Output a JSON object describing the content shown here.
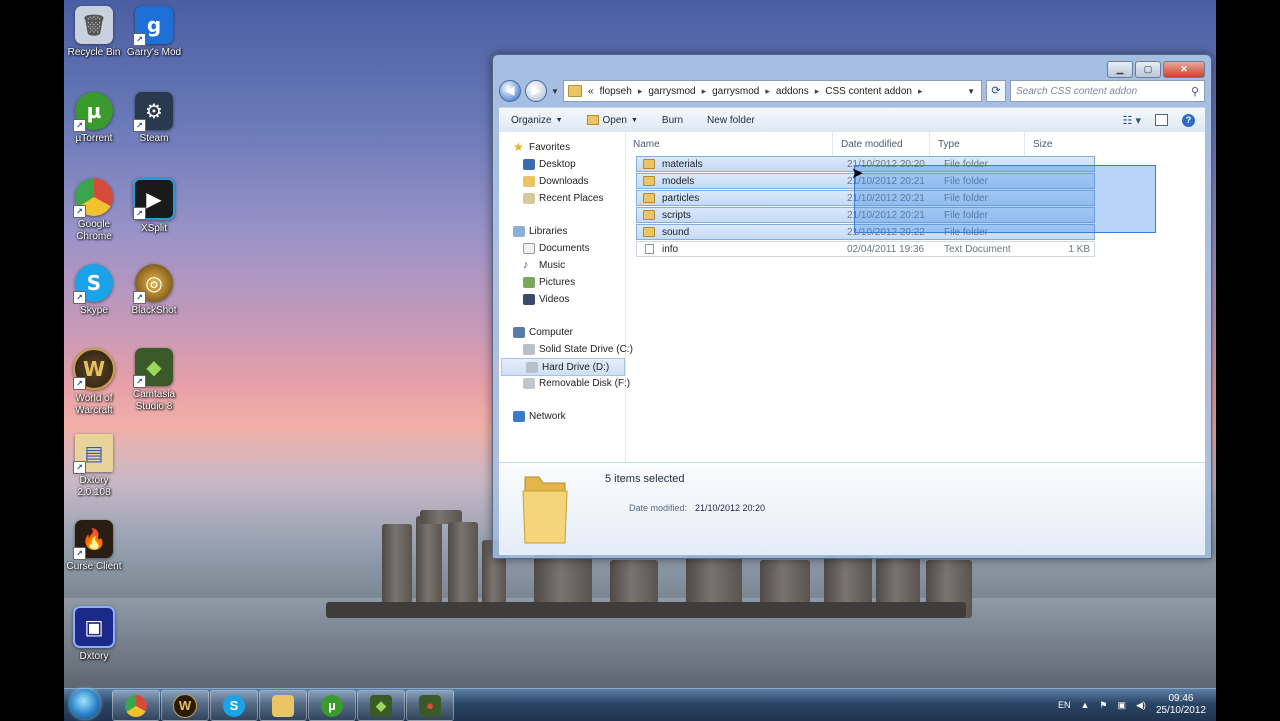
{
  "desktop": {
    "icons": [
      {
        "label": "Recycle Bin",
        "glyph": "🗑",
        "color": "#c9d2dc",
        "icon": "recycle-bin-icon"
      },
      {
        "label": "Garry's Mod",
        "glyph": "g",
        "color": "#1e6fd6",
        "icon": "garrys-mod-icon"
      },
      {
        "label": "µTorrent",
        "glyph": "µ",
        "color": "#3a9a2c",
        "icon": "utorrent-icon"
      },
      {
        "label": "Steam",
        "glyph": "⚙",
        "color": "#2a3a4e",
        "icon": "steam-icon"
      },
      {
        "label": "Google Chrome",
        "glyph": "◉",
        "color": "#d64a3a",
        "icon": "chrome-icon"
      },
      {
        "label": "XSplit",
        "glyph": "▶",
        "color": "#1a1a1a",
        "icon": "xsplit-icon"
      },
      {
        "label": "Skype",
        "glyph": "S",
        "color": "#1aa3e8",
        "icon": "skype-icon"
      },
      {
        "label": "BlackShot",
        "glyph": "◎",
        "color": "#8a6a1a",
        "icon": "blackshot-icon"
      },
      {
        "label": "World of Warcraft",
        "glyph": "W",
        "color": "#9a7a2a",
        "icon": "wow-icon"
      },
      {
        "label": "Camtasia Studio 8",
        "glyph": "◆",
        "color": "#3a5a2a",
        "icon": "camtasia-icon"
      },
      {
        "label": "Dxtory 2.0.108",
        "glyph": "▤",
        "color": "#d8c89a",
        "icon": "dxtory-folder-icon"
      },
      {
        "label": "Curse Client",
        "glyph": "🔥",
        "color": "#3a2a1a",
        "icon": "curse-icon"
      },
      {
        "label": "Dxtory",
        "glyph": "▣",
        "color": "#1b2a8a",
        "icon": "dxtory-icon"
      }
    ]
  },
  "window": {
    "address": {
      "overflow": "«",
      "crumbs": [
        "flopseh",
        "garrysmod",
        "garrysmod",
        "addons",
        "CSS content addon"
      ]
    },
    "search_placeholder": "Search CSS content addon",
    "toolbar": {
      "organize": "Organize",
      "open": "Open",
      "burn": "Burn",
      "new_folder": "New folder"
    },
    "nav": {
      "favorites": "Favorites",
      "desktop": "Desktop",
      "downloads": "Downloads",
      "recent": "Recent Places",
      "libraries": "Libraries",
      "documents": "Documents",
      "music": "Music",
      "pictures": "Pictures",
      "videos": "Videos",
      "computer": "Computer",
      "ssd": "Solid State Drive (C:)",
      "hdd": "Hard Drive (D:)",
      "removable": "Removable Disk (F:)",
      "network": "Network"
    },
    "columns": {
      "name": "Name",
      "date": "Date modified",
      "type": "Type",
      "size": "Size"
    },
    "files": [
      {
        "name": "materials",
        "date": "21/10/2012 20:20",
        "type": "File folder",
        "size": ""
      },
      {
        "name": "models",
        "date": "21/10/2012 20:21",
        "type": "File folder",
        "size": ""
      },
      {
        "name": "particles",
        "date": "21/10/2012 20:21",
        "type": "File folder",
        "size": ""
      },
      {
        "name": "scripts",
        "date": "21/10/2012 20:21",
        "type": "File folder",
        "size": ""
      },
      {
        "name": "sound",
        "date": "21/10/2012 20:22",
        "type": "File folder",
        "size": ""
      },
      {
        "name": "info",
        "date": "02/04/2011 19:36",
        "type": "Text Document",
        "size": "1 KB"
      }
    ],
    "details": {
      "count": "5 items selected",
      "date_label": "Date modified:",
      "date_value": "21/10/2012 20:20"
    }
  },
  "taskbar": {
    "lang": "EN",
    "time": "09:46",
    "date": "25/10/2012"
  }
}
